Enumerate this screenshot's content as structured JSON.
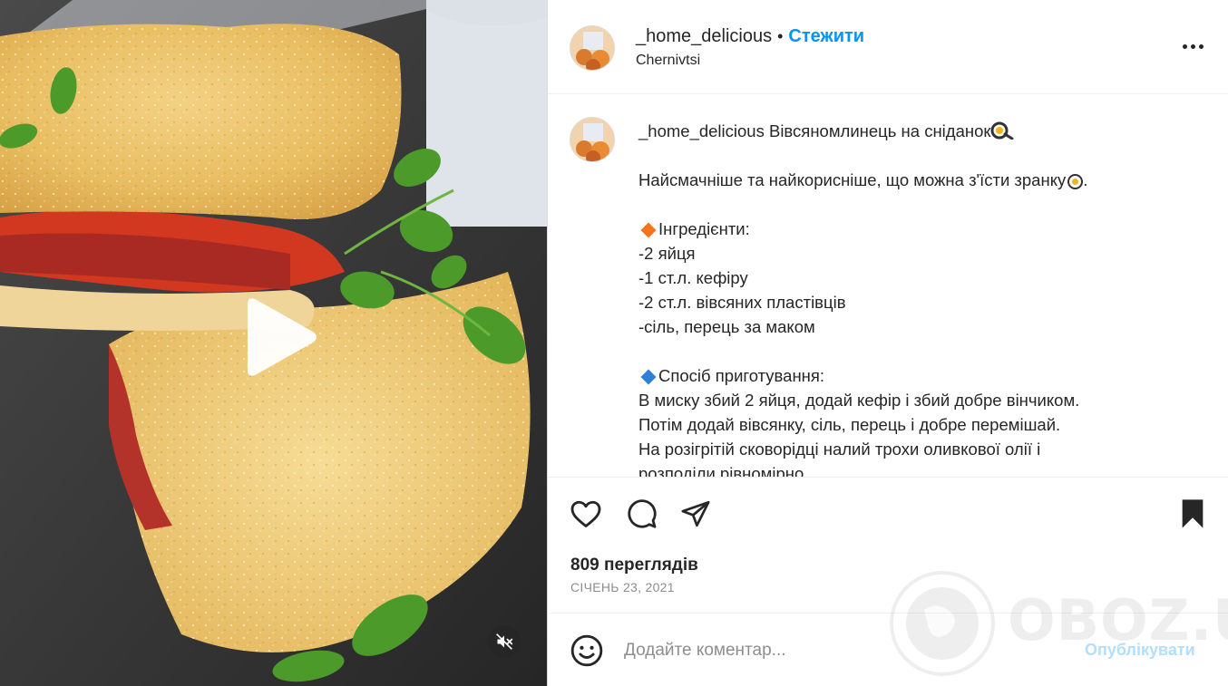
{
  "post": {
    "username": "_home_delicious",
    "separator": "•",
    "follow_label": "Стежити",
    "location": "Chernivtsi"
  },
  "caption": {
    "username": "_home_delicious",
    "title": "Вівсяномлинець на сніданок",
    "lines": [
      "Найсмачніше та найкорисніше, що можна з'їсти зранку",
      "",
      "Інгредієнти:",
      "-2 яйця",
      "-1 ст.л. кефіру",
      "-2 ст.л. вівсяних пластівців",
      "-сіль, перець за маком",
      "",
      "Спосіб приготування:",
      "В миску збий 2 яйця, додай кефір і збий добре вінчиком.",
      "Потім додай вівсянку, сіль, перець і добре перемішай.",
      "На розігрітій сковорідці налий трохи оливкової олії і",
      "розподіли рівномірно"
    ]
  },
  "stats": {
    "views_count": "809",
    "views_label": "переглядів",
    "date": "СІЧЕНЬ 23, 2021"
  },
  "comment": {
    "placeholder": "Додайте коментар...",
    "publish_label": "Опублікувати"
  },
  "watermark": {
    "text": "OBOZ.UA"
  },
  "icons": {
    "like": "heart-icon",
    "comment": "comment-bubble-icon",
    "share": "paper-plane-icon",
    "save": "bookmark-icon",
    "play": "play-icon",
    "mute": "speaker-muted-icon",
    "more": "ellipsis-icon",
    "emoji": "smiley-icon"
  },
  "colors": {
    "accent": "#0095f6",
    "publish_disabled": "#b2dffc",
    "secondary_text": "#8e8e8e",
    "diamond_orange": "#f4731d",
    "diamond_blue": "#2f7fd8"
  }
}
